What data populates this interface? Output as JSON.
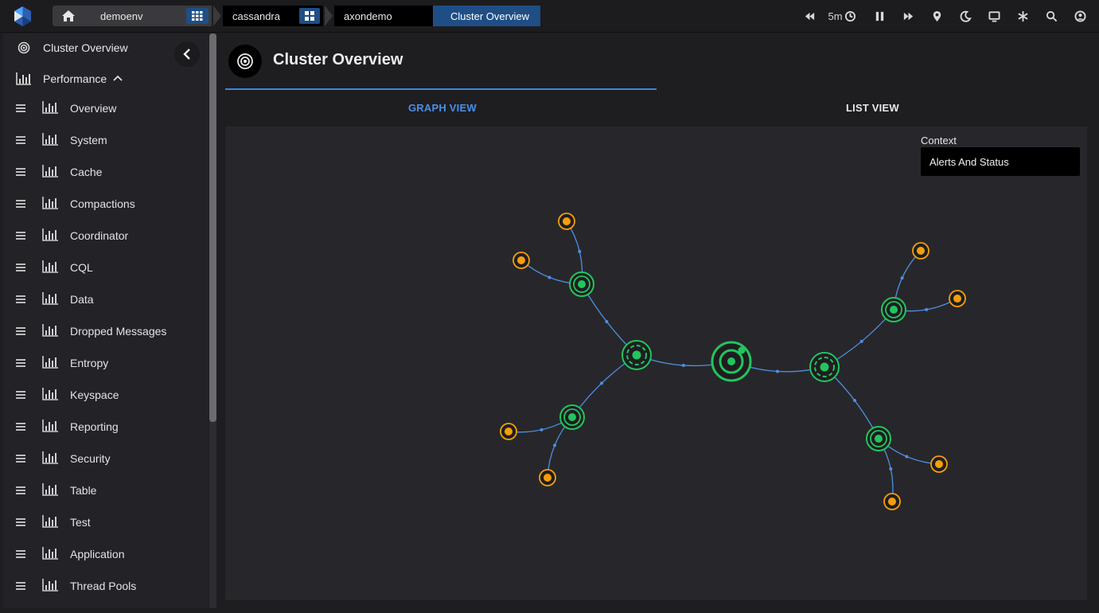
{
  "breadcrumbs": {
    "env": "demoenv",
    "cluster_type": "cassandra",
    "cluster": "axondemo",
    "current": "Cluster Overview"
  },
  "toolbar": {
    "time_range": "5m",
    "icons": [
      "rewind-icon",
      "clock-icon",
      "pause-icon",
      "forward-icon",
      "pin-icon",
      "moon-icon",
      "monitor-icon",
      "snowflake-icon",
      "search-icon",
      "user-icon"
    ]
  },
  "sidebar": {
    "header": "Cluster Overview",
    "group": "Performance",
    "items": [
      {
        "label": "Overview"
      },
      {
        "label": "System"
      },
      {
        "label": "Cache"
      },
      {
        "label": "Compactions"
      },
      {
        "label": "Coordinator"
      },
      {
        "label": "CQL"
      },
      {
        "label": "Data"
      },
      {
        "label": "Dropped Messages"
      },
      {
        "label": "Entropy"
      },
      {
        "label": "Keyspace"
      },
      {
        "label": "Reporting"
      },
      {
        "label": "Security"
      },
      {
        "label": "Table"
      },
      {
        "label": "Test"
      },
      {
        "label": "Application"
      },
      {
        "label": "Thread Pools"
      }
    ]
  },
  "page": {
    "title": "Cluster Overview",
    "tabs": {
      "graph": "GRAPH VIEW",
      "list": "LIST VIEW"
    },
    "context_label": "Context",
    "context_value": "Alerts And Status"
  },
  "colors": {
    "accent": "#3d84e0",
    "node_ok": "#22c55e",
    "node_leaf": "#f59e0b",
    "edge": "#4f8fe0"
  }
}
